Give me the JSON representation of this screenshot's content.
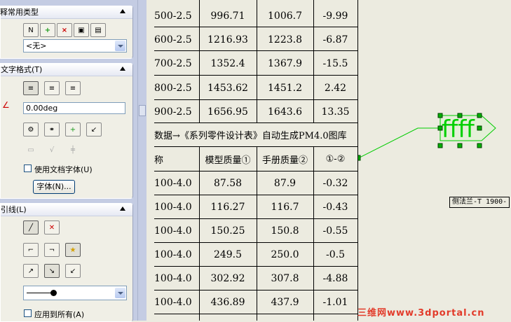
{
  "panel": {
    "annotation_types": {
      "title": "注释常用类型",
      "dropdown_value": "<无>"
    },
    "text_format": {
      "title": "文字格式(T)",
      "angle_value": "0.00deg",
      "use_doc_font_label": "使用文档字体(U)",
      "font_button_label": "字体(N)..."
    },
    "leader": {
      "title": "引线(L)",
      "apply_all_label": "应用到所有(A)"
    }
  },
  "table": {
    "upper_rows": [
      {
        "name": "500-2.5",
        "model": "996.71",
        "manual": "1006.7",
        "diff": "-9.99"
      },
      {
        "name": "600-2.5",
        "model": "1216.93",
        "manual": "1223.8",
        "diff": "-6.87"
      },
      {
        "name": "700-2.5",
        "model": "1352.4",
        "manual": "1367.9",
        "diff": "-15.5"
      },
      {
        "name": "800-2.5",
        "model": "1453.62",
        "manual": "1451.2",
        "diff": "2.42"
      },
      {
        "name": "900-2.5",
        "model": "1656.95",
        "manual": "1643.6",
        "diff": "13.35"
      }
    ],
    "section_title": "数据→《系列零件设计表》自动生成PM4.0图库",
    "headers": {
      "name": "称",
      "model": "模型质量①",
      "manual": "手册质量②",
      "diff": "①-②"
    },
    "lower_rows": [
      {
        "name": "100-4.0",
        "model": "87.58",
        "manual": "87.9",
        "diff": "-0.32"
      },
      {
        "name": "100-4.0",
        "model": "116.27",
        "manual": "116.7",
        "diff": "-0.43"
      },
      {
        "name": "100-4.0",
        "model": "150.25",
        "manual": "150.8",
        "diff": "-0.55"
      },
      {
        "name": "100-4.0",
        "model": "249.5",
        "manual": "250.0",
        "diff": "-0.5"
      },
      {
        "name": "100-4.0",
        "model": "302.92",
        "manual": "307.8",
        "diff": "-4.88"
      },
      {
        "name": "100-4.0",
        "model": "436.89",
        "manual": "437.9",
        "diff": "-1.01"
      }
    ]
  },
  "drawing": {
    "note_text": "ffff",
    "leader_tag": "侧法兰-T 1900-",
    "note_color": "#00d000"
  },
  "watermark": "三维网www.3dportal.cn"
}
